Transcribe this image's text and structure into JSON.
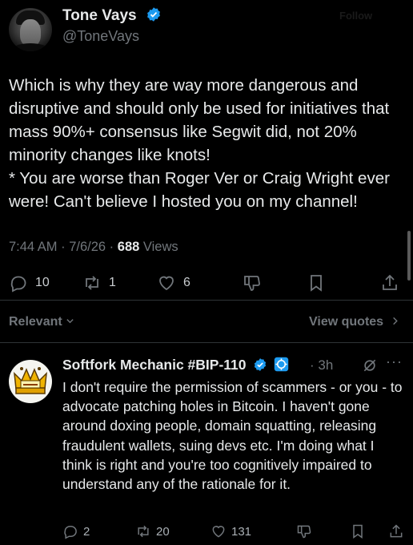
{
  "tweet": {
    "author_name": "Tone Vays",
    "author_handle": "@ToneVays",
    "follow_label": "Follow",
    "text": "Which is why they are way more dangerous and disruptive and should only be used for initiatives that mass 90%+ consensus like Segwit did, not 20% minority changes like knots!\n* You are worse than Roger Ver or Craig Wright ever were! Can't believe I hosted you on my channel!",
    "time": "7:44 AM",
    "date": "7/6/26",
    "views_count": "688",
    "views_label": "Views",
    "replies": "10",
    "reposts": "1",
    "likes": "6"
  },
  "replies_header": {
    "sort_label": "Relevant",
    "view_quotes_label": "View quotes"
  },
  "reply": {
    "author_name": "Softfork Mechanic #BIP-110",
    "time": "3h",
    "text": "I don't require the permission of scammers - or you - to advocate patching holes in Bitcoin. I haven't gone around doxing people, domain squatting, releasing fraudulent wallets, suing devs etc. I'm doing what I think is right and you're too cognitively impaired to understand any of the rationale for it.",
    "replies": "2",
    "reposts": "20",
    "likes": "131"
  },
  "colors": {
    "background": "#000000",
    "text": "#e7e9ea",
    "muted": "#71767b",
    "verified": "#1d9bf0",
    "divider": "#2f3336"
  }
}
